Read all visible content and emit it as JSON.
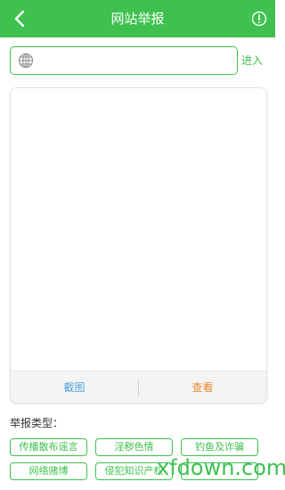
{
  "header": {
    "title": "网站举报"
  },
  "url_bar": {
    "value": "",
    "placeholder": "",
    "enter_label": "进入"
  },
  "preview": {
    "screenshot_label": "截图",
    "view_label": "查看"
  },
  "report_types": {
    "heading": "举报类型：",
    "tags": [
      "传播散布谣言",
      "淫秽色情",
      "钓鱼及诈骗",
      "网络赌博",
      "侵犯知识产权",
      ""
    ]
  },
  "watermark": {
    "text": "xfdown.com"
  },
  "colors": {
    "primary": "#3ec14f",
    "screenshot": "#4aa3d6",
    "view": "#e58a2e"
  }
}
